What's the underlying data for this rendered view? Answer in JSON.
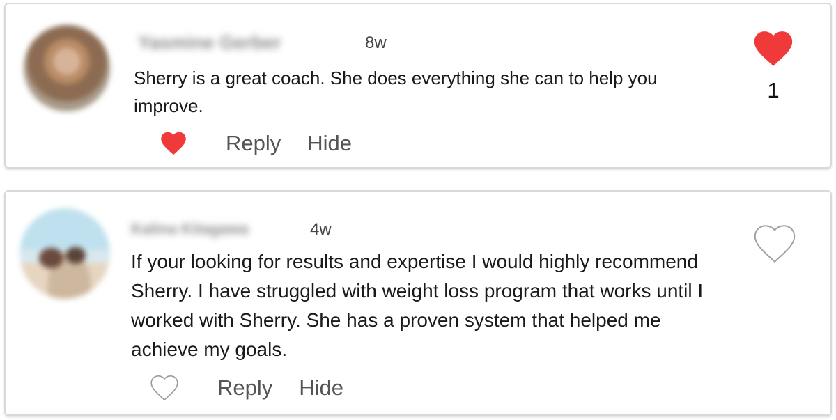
{
  "colors": {
    "heart_red": "#f03a3a",
    "heart_outline": "#9a9a9a"
  },
  "comments": [
    {
      "author_name": "Yasmine Gerber",
      "avatar": "avatar-photo",
      "time": "8w",
      "text": "Sherry is a great coach. She does everything she can to help you improve.",
      "like_count": "1",
      "liked": true,
      "actions": {
        "reply": "Reply",
        "hide": "Hide"
      }
    },
    {
      "author_name": "Kalina Kitagawa",
      "avatar": "avatar-photo",
      "time": "4w",
      "text": "If your looking for results and expertise I would highly recommend Sherry. I have struggled with weight loss program that works until I worked with Sherry. She has a proven system that helped me achieve my goals.",
      "like_count": "",
      "liked": false,
      "actions": {
        "reply": "Reply",
        "hide": "Hide"
      }
    }
  ]
}
